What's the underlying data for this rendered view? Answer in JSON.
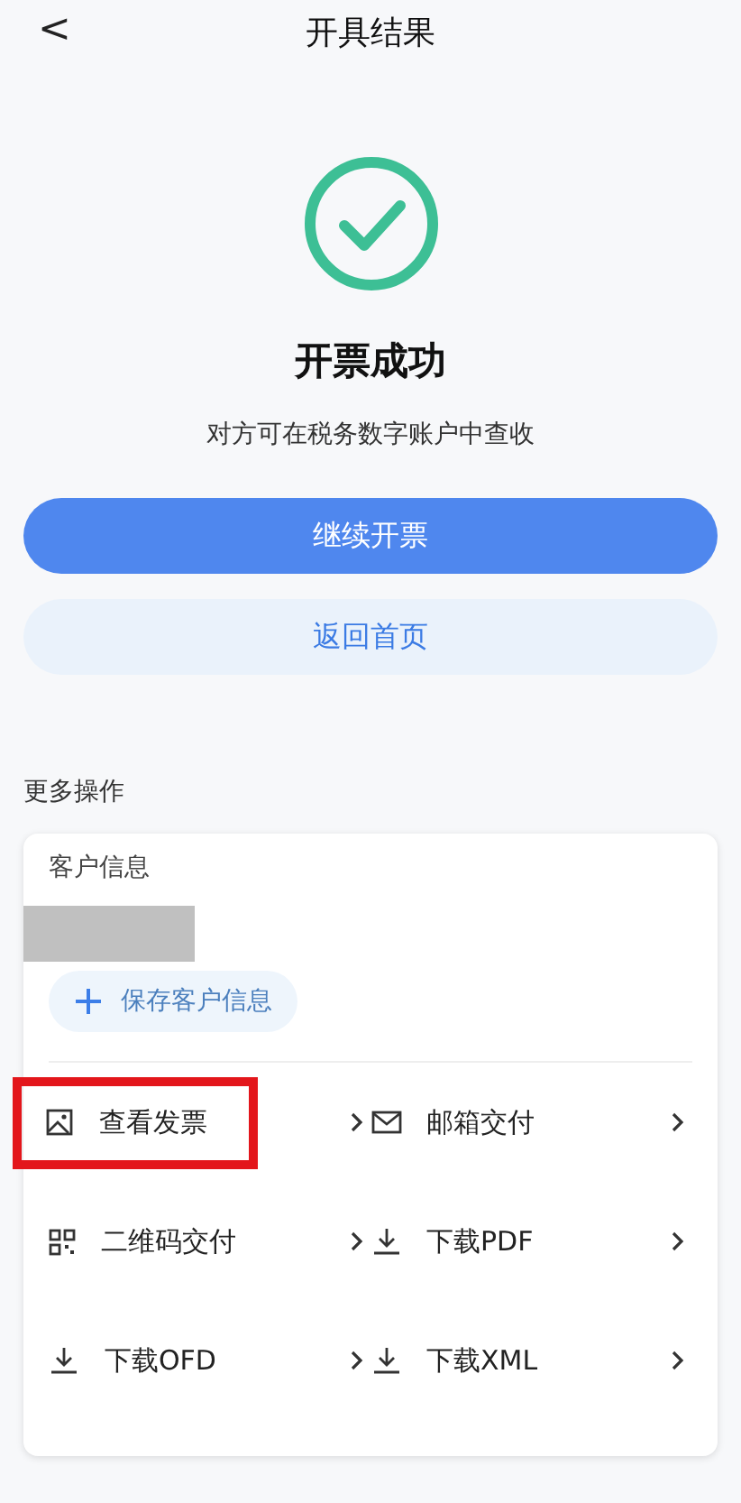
{
  "header": {
    "back": "<",
    "title": "开具结果"
  },
  "result": {
    "success": true,
    "title": "开票成功",
    "subtitle": "对方可在税务数字账户中查收"
  },
  "buttons": [
    {
      "label": "继续开票",
      "kind": "primary"
    },
    {
      "label": "返回首页",
      "kind": "secondary"
    }
  ],
  "more": {
    "heading": "更多操作",
    "customer_label": "客户信息",
    "redacted": true,
    "save_button": "保存客户信息",
    "actions": [
      {
        "label": "查看发票",
        "kind": "image",
        "highlighted": true
      },
      {
        "label": "邮箱交付",
        "kind": "mail",
        "highlighted": false
      },
      {
        "label": "二维码交付",
        "kind": "qr",
        "highlighted": false
      },
      {
        "label": "下载PDF",
        "kind": "download",
        "highlighted": false
      },
      {
        "label": "下载OFD",
        "kind": "download",
        "highlighted": false
      },
      {
        "label": "下载XML",
        "kind": "download",
        "highlighted": false
      }
    ]
  }
}
